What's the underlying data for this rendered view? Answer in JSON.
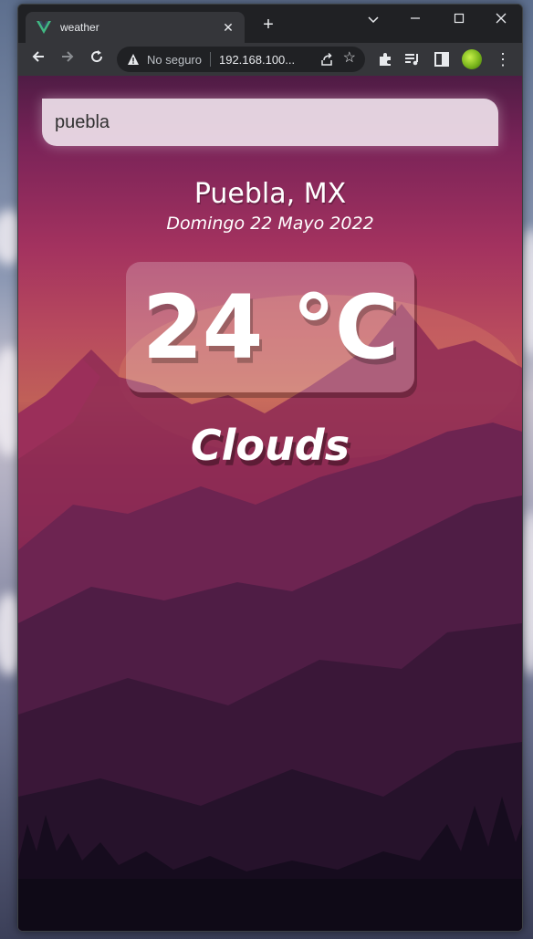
{
  "browser": {
    "tab_title": "weather",
    "new_tab_label": "+",
    "omnibox": {
      "security_text": "No seguro",
      "url": "192.168.100..."
    }
  },
  "app": {
    "search": {
      "value": "puebla",
      "placeholder": ""
    },
    "location": "Puebla, MX",
    "date": "Domingo 22 Mayo 2022",
    "temperature": "24 °C",
    "weather": "Clouds"
  },
  "colors": {
    "accent_vue": "#41b883",
    "browser_chrome": "#202124",
    "toolbar": "#35363a",
    "sky_magenta": "#a3325f"
  }
}
